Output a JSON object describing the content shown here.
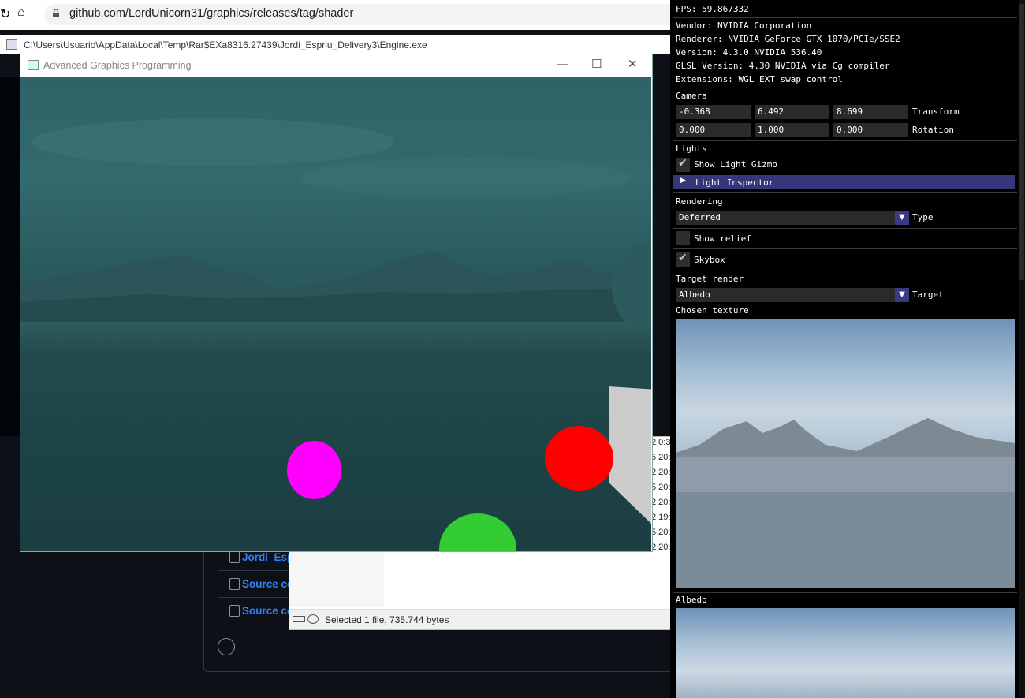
{
  "browser": {
    "url": "github.com/LordUnicorn31/graphics/releases/tag/shader"
  },
  "console": {
    "title": "C:\\Users\\Usuario\\AppData\\Local\\Temp\\Rar$EXa8316.27439\\Jordi_Espriu_Delivery3\\Engine.exe"
  },
  "engine": {
    "title": "Advanced Graphics Programming",
    "minimize": "—",
    "maximize": "☐",
    "close": "✕"
  },
  "github": {
    "assets": [
      {
        "label": "Jordi_Esp"
      },
      {
        "label": "Source co"
      },
      {
        "label": "Source co"
      }
    ]
  },
  "explorer": {
    "status": "Selected 1 file, 735.744 bytes",
    "dates": [
      "2 0:3",
      "5 20:",
      "2 20:",
      "5 20:",
      "2 20:",
      "2 19:",
      "5 20:",
      "2 20:"
    ]
  },
  "panel": {
    "fps": "FPS: 59.867332",
    "vendor": "Vendor: NVIDIA Corporation",
    "renderer": "Renderer: NVIDIA GeForce GTX 1070/PCIe/SSE2",
    "version": "Version: 4.3.0 NVIDIA 536.40",
    "glsl": "GLSL Version: 4.30 NVIDIA via Cg compiler",
    "extensions": "Extensions: WGL_EXT_swap_control",
    "camera_header": "Camera",
    "transform": {
      "x": "-0.368",
      "y": "6.492",
      "z": "8.699",
      "label": "Transform"
    },
    "rotation": {
      "x": "0.000",
      "y": "1.000",
      "z": "0.000",
      "label": "Rotation"
    },
    "lights_header": "Lights",
    "show_light_gizmo": {
      "label": "Show Light Gizmo",
      "checked": true
    },
    "light_inspector": "Light Inspector",
    "rendering_header": "Rendering",
    "rendering_type": {
      "value": "Deferred",
      "label": "Type"
    },
    "show_relief": {
      "label": "Show relief",
      "checked": false
    },
    "skybox": {
      "label": "Skybox",
      "checked": true
    },
    "target_header": "Target render",
    "target": {
      "value": "Albedo",
      "label": "Target"
    },
    "chosen_texture": "Chosen texture",
    "albedo_label": "Albedo"
  },
  "colors": {
    "panel_bg": "#000000",
    "header_active": "#36367a",
    "sky_tint": "#2e6468"
  }
}
